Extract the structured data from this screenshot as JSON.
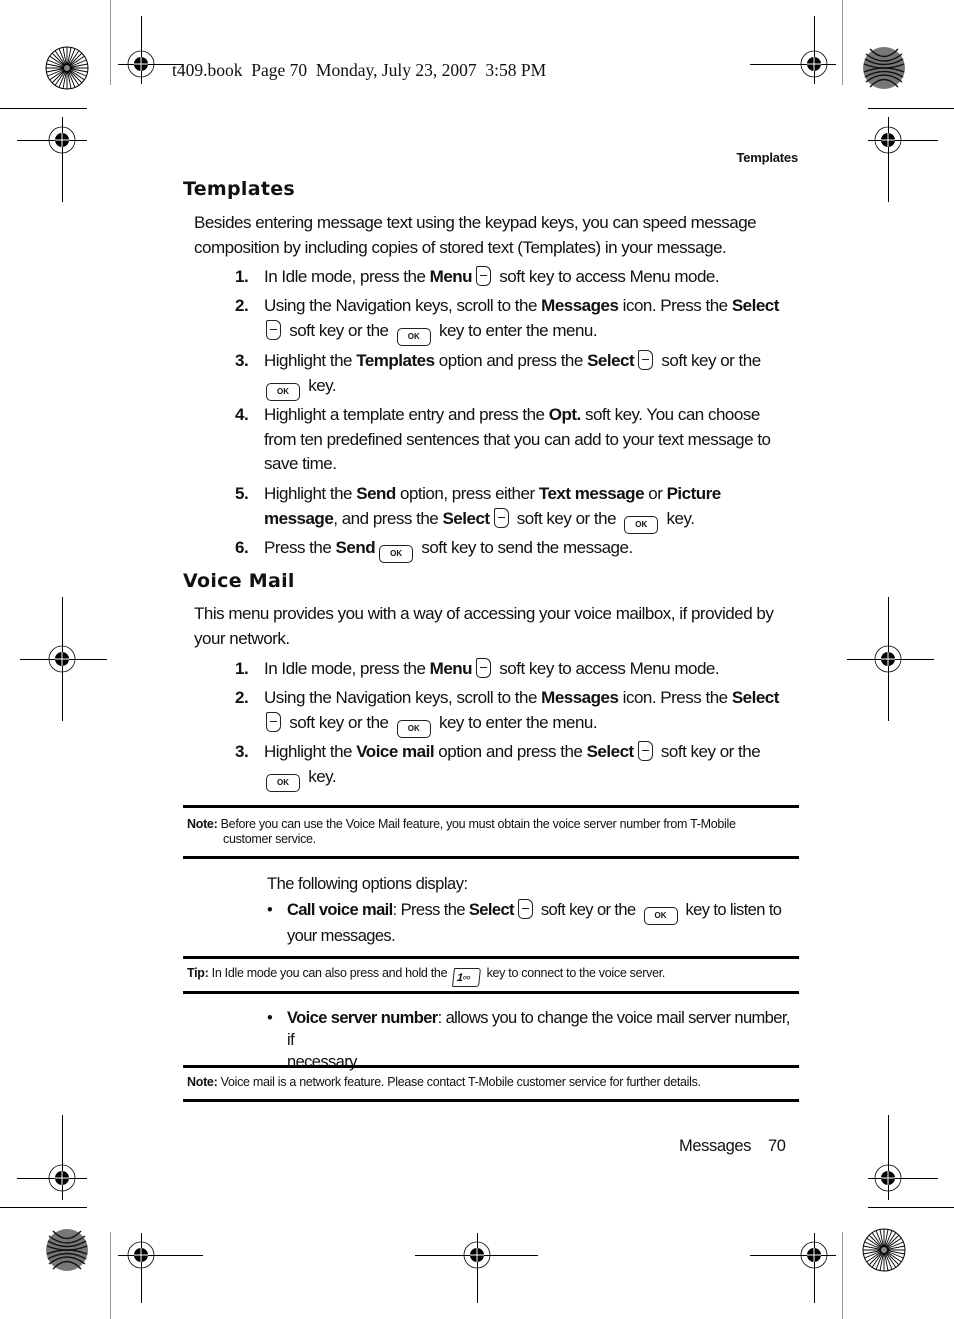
{
  "print_slug": "t409.book  Page 70  Monday, July 23, 2007  3:58 PM",
  "running_head": "Templates",
  "sections": {
    "templates": {
      "title": "Templates",
      "intro_line1": "Besides entering message text using the keypad keys, you can speed message",
      "intro_line2": "composition by including copies of stored text (Templates) in your message.",
      "steps": [
        {
          "num": "1.",
          "parts": [
            "In Idle mode, press the ",
            "Menu",
            " soft key to access Menu mode."
          ]
        },
        {
          "num": "2.",
          "parts": [
            "Using the Navigation keys, scroll to the ",
            "Messages",
            " icon. Press the ",
            "Select",
            " soft key or the ",
            " key to enter the menu."
          ]
        },
        {
          "num": "3.",
          "parts": [
            "Highlight the ",
            "Templates",
            " option and press the ",
            "Select",
            " soft key or the",
            " key."
          ]
        },
        {
          "num": "4.",
          "parts": [
            "Highlight a template entry and press the ",
            "Opt.",
            " soft key. You can choose",
            "from ten predefined sentences that you can add to your text message to",
            "save time."
          ]
        },
        {
          "num": "5.",
          "parts": [
            "Highlight the ",
            "Send",
            " option, press either ",
            "Text message",
            " or ",
            "Picture",
            "message",
            ", and press the ",
            "Select",
            " soft key or the ",
            " key."
          ]
        },
        {
          "num": "6.",
          "parts": [
            "Press the ",
            "Send",
            " soft key to send the message."
          ]
        }
      ]
    },
    "voice_mail": {
      "title": "Voice Mail",
      "intro_line1": "This menu provides you with a way of accessing your voice mailbox, if provided by",
      "intro_line2": "your network.",
      "steps": [
        {
          "num": "1.",
          "parts": [
            "In Idle mode, press the ",
            "Menu",
            " soft key to access Menu mode."
          ]
        },
        {
          "num": "2.",
          "parts": [
            "Using the Navigation keys, scroll to the ",
            "Messages",
            " icon. Press the ",
            "Select",
            " soft key or the ",
            " key to enter the menu."
          ]
        },
        {
          "num": "3.",
          "parts": [
            "Highlight the ",
            "Voice mail",
            " option and press the ",
            "Select",
            " soft key or the",
            " key."
          ]
        }
      ],
      "note1": {
        "label": "Note:",
        "line1": " Before you can use the Voice Mail feature, you must obtain the voice server number from T-Mobile",
        "line2": "customer service."
      },
      "options_intro": "The following options display:",
      "bullets": [
        {
          "bold": "Call voice mail",
          "parts": [
            ": Press the ",
            "Select",
            " soft key or the ",
            " key to listen to",
            "your messages."
          ]
        },
        {
          "bold": "Voice server number",
          "parts": [
            ": allows you to change the voice mail server number, if",
            "necessary."
          ]
        }
      ],
      "tip": {
        "label": "Tip:",
        "before": " In Idle mode you can also press and hold the ",
        "key_label": "1",
        "after": " key to connect to the voice server."
      },
      "note2": {
        "label": "Note:",
        "text": " Voice mail is a network feature. Please contact T-Mobile customer service for further details."
      }
    }
  },
  "keys": {
    "ok_label": "OK"
  },
  "footer": {
    "section": "Messages",
    "page": "70"
  }
}
